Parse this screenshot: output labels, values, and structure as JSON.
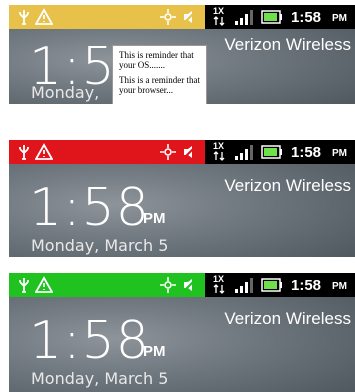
{
  "status": {
    "network": "1X",
    "time": "1:58",
    "time_suffix": "PM"
  },
  "lockscreen": {
    "time": "1:58",
    "ampm": "PM",
    "carrier": "Verizon Wireless",
    "date": "Monday, March 5",
    "date_partial": "Monday,"
  },
  "panels": [
    {
      "notification_color": "#e8c14a",
      "label": "yellow"
    },
    {
      "notification_color": "#e0141b",
      "label": "red"
    },
    {
      "notification_color": "#1fc21f",
      "label": "green"
    }
  ],
  "callout": {
    "line1": "This is reminder that your OS.......",
    "line2": "This is a reminder that your browser..."
  }
}
